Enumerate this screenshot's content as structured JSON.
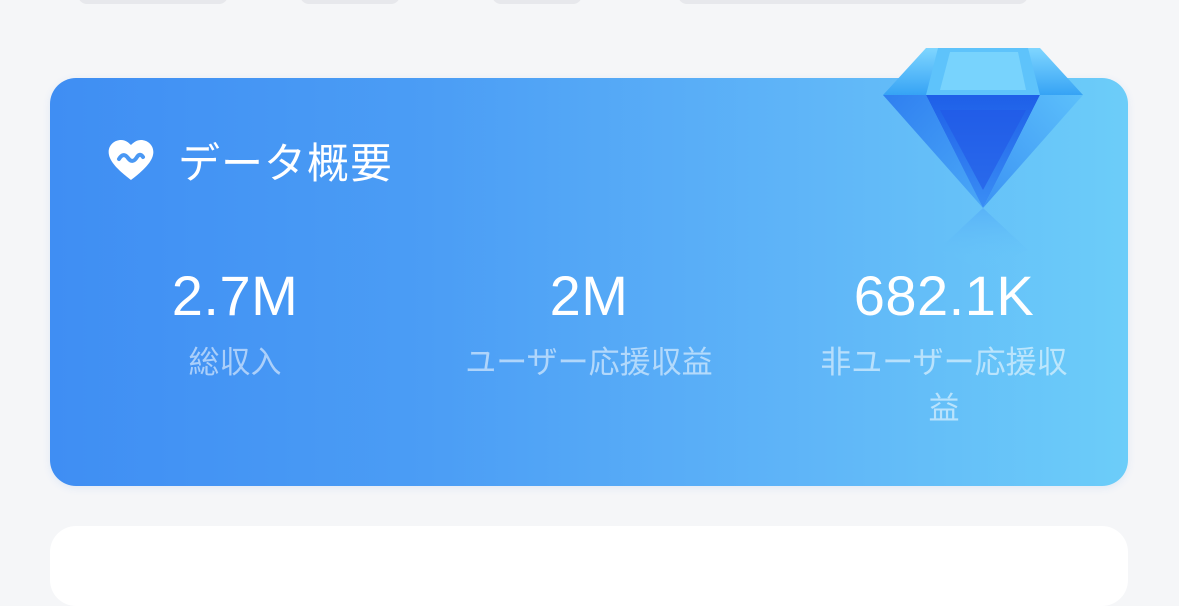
{
  "overview": {
    "title": "データ概要",
    "icon": "heart-badge-icon",
    "gem_icon": "diamond-gem-icon",
    "accent_start": "#3f8ef3",
    "accent_end": "#6ccdf9",
    "stats": [
      {
        "value": "2.7M",
        "label": "総収入"
      },
      {
        "value": "2M",
        "label": "ユーザー応援収益"
      },
      {
        "value": "682.1K",
        "label": "非ユーザー応援収益"
      }
    ]
  }
}
